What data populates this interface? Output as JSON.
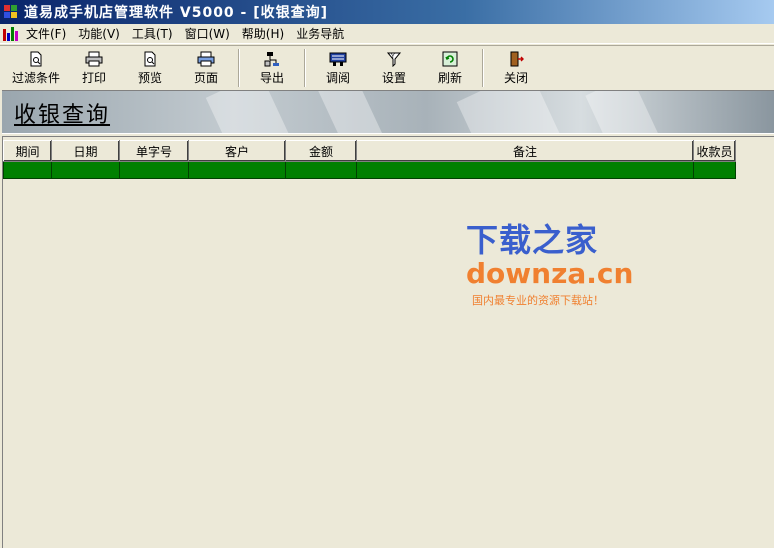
{
  "window": {
    "title": "道易成手机店管理软件 V5000 - [收银查询]"
  },
  "menu": {
    "items": [
      "文件(F)",
      "功能(V)",
      "工具(T)",
      "窗口(W)",
      "帮助(H)",
      "业务导航"
    ]
  },
  "toolbar": {
    "buttons": [
      {
        "label": "过滤条件",
        "icon": "filter-doc-icon"
      },
      {
        "label": "打印",
        "icon": "printer-icon"
      },
      {
        "label": "预览",
        "icon": "preview-doc-icon"
      },
      {
        "label": "页面",
        "icon": "page-setup-icon"
      },
      {
        "label": "导出",
        "icon": "export-icon"
      },
      {
        "label": "调阅",
        "icon": "browse-icon"
      },
      {
        "label": "设置",
        "icon": "settings-funnel-icon"
      },
      {
        "label": "刷新",
        "icon": "refresh-icon"
      },
      {
        "label": "关闭",
        "icon": "exit-door-icon"
      }
    ]
  },
  "page": {
    "title": "收银查询"
  },
  "grid": {
    "columns": [
      "期间",
      "日期",
      "单字号",
      "客户",
      "金额",
      "备注",
      "收款员"
    ],
    "rows": [
      [
        "",
        "",
        "",
        "",
        "",
        "",
        ""
      ]
    ],
    "row_color": "#008000"
  },
  "watermark": {
    "cn": "下载之家",
    "en": "downza.cn",
    "tagline": "国内最专业的资源下载站！"
  },
  "colors": {
    "titlebar": "#0a246a",
    "background": "#ece9d8",
    "selected_row": "#008000",
    "watermark_blue": "#3a5fcd",
    "watermark_orange": "#f08030"
  }
}
